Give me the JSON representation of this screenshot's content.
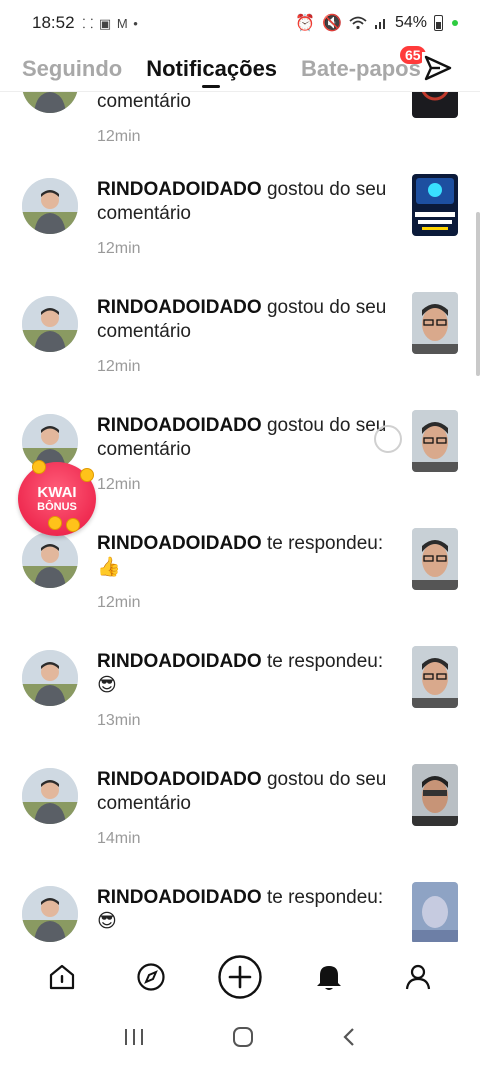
{
  "status_bar": {
    "time": "18:52",
    "left_icons": "⸬ ▣ M •",
    "battery_percent": "54%"
  },
  "header": {
    "tabs": [
      {
        "label": "Seguindo",
        "active": false
      },
      {
        "label": "Notificações",
        "active": true
      },
      {
        "label": "Bate-papos",
        "active": false
      }
    ],
    "chat_badge": "65",
    "send_icon": "send-icon"
  },
  "notifications": [
    {
      "user": "",
      "action": "",
      "second_line": "comentário",
      "time": "12min",
      "thumb": "car-dashboard"
    },
    {
      "user": "RINDOADOIDADO",
      "action": "gostou do seu",
      "second_line": "comentário",
      "time": "12min",
      "thumb": "trabalhe-em-casa"
    },
    {
      "user": "RINDOADOIDADO",
      "action": "gostou do seu",
      "second_line": "comentário",
      "time": "12min",
      "thumb": "man-glasses"
    },
    {
      "user": "RINDOADOIDADO",
      "action": "gostou do seu",
      "second_line": "comentário",
      "time": "12min",
      "thumb": "man-glasses"
    },
    {
      "user": "RINDOADOIDADO",
      "action": "te respondeu:",
      "second_line": "👍",
      "time": "12min",
      "thumb": "man-glasses"
    },
    {
      "user": "RINDOADOIDADO",
      "action": "te respondeu:",
      "second_line": "😎",
      "time": "13min",
      "thumb": "man-glasses"
    },
    {
      "user": "RINDOADOIDADO",
      "action": "gostou do seu",
      "second_line": "comentário",
      "time": "14min",
      "thumb": "man-glasses-dark"
    },
    {
      "user": "RINDOADOIDADO",
      "action": "te respondeu:",
      "second_line": "😎",
      "time": "",
      "thumb": "man-blurred"
    }
  ],
  "kwai_bonus": {
    "title": "KWAI",
    "subtitle": "BÔNUS"
  },
  "bottom_nav": [
    {
      "icon": "home-icon"
    },
    {
      "icon": "discover-icon"
    },
    {
      "icon": "create-icon"
    },
    {
      "icon": "notifications-bell-icon"
    },
    {
      "icon": "profile-icon"
    }
  ],
  "system_nav": [
    {
      "icon": "recent-apps-icon"
    },
    {
      "icon": "home-circle-icon"
    },
    {
      "icon": "back-icon"
    }
  ],
  "colors": {
    "badge": "#ff3b3b",
    "kwai": "#e8153f",
    "inactive_tab": "#a8a8a8"
  }
}
